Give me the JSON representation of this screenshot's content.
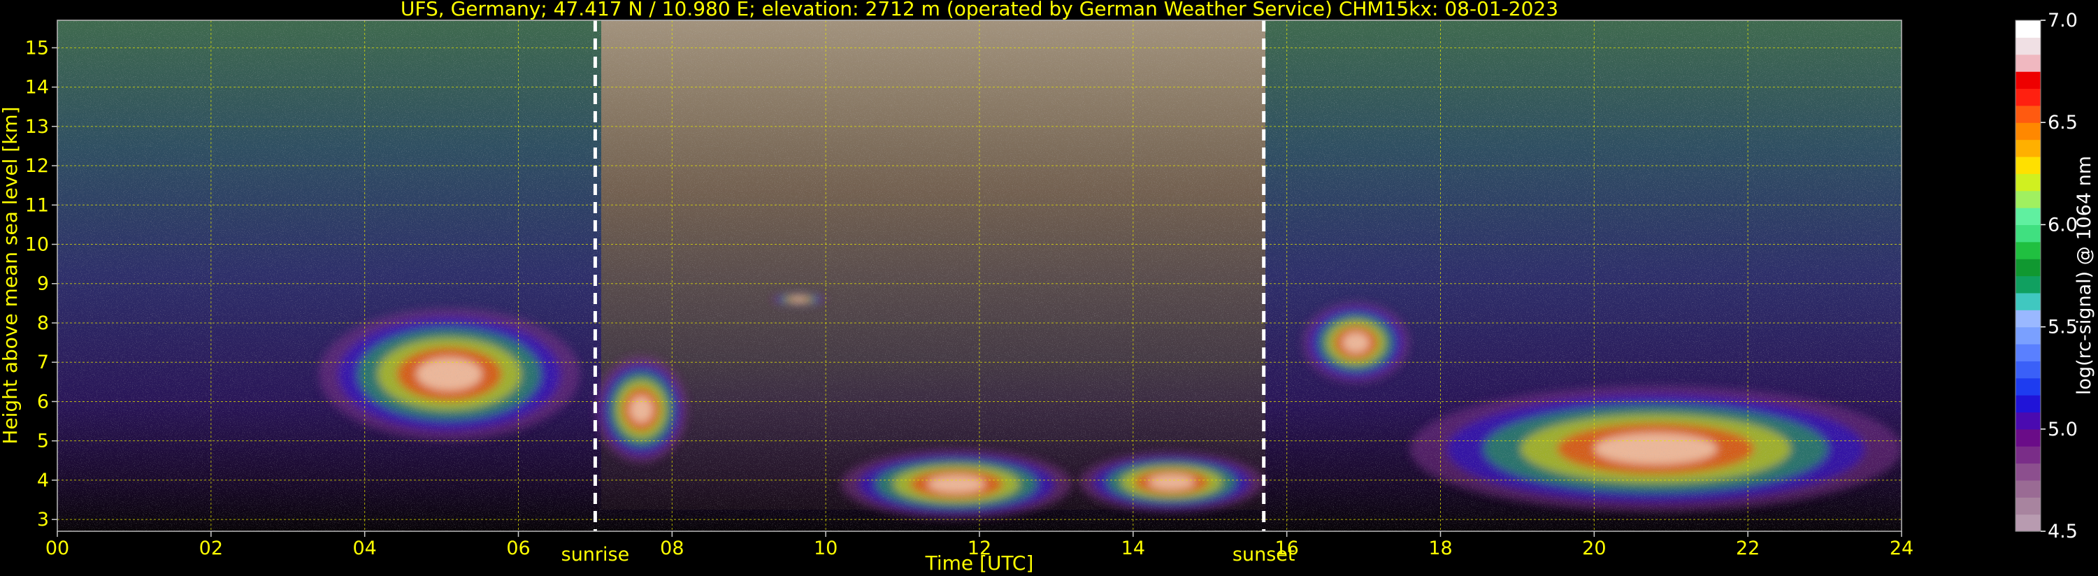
{
  "chart_data": {
    "type": "heatmap",
    "title": "UFS, Germany; 47.417 N / 10.980 E; elevation: 2712 m  (operated by German Weather Service)    CHM15kx: 08-01-2023",
    "xlabel": "Time [UTC]",
    "ylabel": "Height above mean sea level [km]",
    "xlim": [
      0,
      24
    ],
    "ylim": [
      2.7,
      15.7
    ],
    "x_ticks": [
      "00",
      "02",
      "04",
      "06",
      "08",
      "10",
      "12",
      "14",
      "16",
      "18",
      "20",
      "22",
      "24"
    ],
    "y_ticks": [
      "3",
      "4",
      "5",
      "6",
      "7",
      "8",
      "9",
      "10",
      "11",
      "12",
      "13",
      "14",
      "15"
    ],
    "grid": true,
    "markers": [
      {
        "label": "sunrise",
        "x": 7.0
      },
      {
        "label": "sunset",
        "x": 15.7
      }
    ],
    "colorbar": {
      "label": "log(rc-signal) @ 1064 nm",
      "range": [
        4.5,
        7.0
      ],
      "ticks": [
        "4.5",
        "5.0",
        "5.5",
        "6.0",
        "6.5",
        "7.0"
      ],
      "colors": [
        "#b89bb0",
        "#a8849f",
        "#9a6b94",
        "#8c4f8e",
        "#7a2d88",
        "#6a0c88",
        "#4a0ab0",
        "#2014d8",
        "#1e3cf0",
        "#3a60f8",
        "#5a80ff",
        "#7aa0ff",
        "#9ab8ff",
        "#40c8c0",
        "#10a060",
        "#109830",
        "#20c040",
        "#40e080",
        "#60f0a0",
        "#a0f060",
        "#d0f020",
        "#ffe000",
        "#ffb000",
        "#ff8800",
        "#ff5a10",
        "#ff2010",
        "#ee0000",
        "#f0b8c0",
        "#f0e0e4",
        "#ffffff"
      ]
    },
    "features": [
      {
        "name": "layer_cloud_a",
        "x": [
          3.4,
          6.8
        ],
        "y": [
          4.6,
          8.8
        ]
      },
      {
        "name": "cloud_b",
        "x": [
          7.0,
          8.2
        ],
        "y": [
          4.1,
          7.5
        ]
      },
      {
        "name": "cloud_c",
        "x": [
          9.3,
          10.0
        ],
        "y": [
          8.4,
          8.8
        ]
      },
      {
        "name": "cloud_d",
        "x": [
          10.2,
          13.2
        ],
        "y": [
          2.8,
          5.0
        ]
      },
      {
        "name": "cloud_e",
        "x": [
          13.3,
          15.7
        ],
        "y": [
          3.0,
          4.9
        ]
      },
      {
        "name": "cloud_f",
        "x": [
          16.2,
          17.6
        ],
        "y": [
          6.2,
          8.8
        ]
      },
      {
        "name": "cloud_g",
        "x": [
          17.6,
          24.0
        ],
        "y": [
          2.8,
          6.8
        ]
      }
    ]
  }
}
